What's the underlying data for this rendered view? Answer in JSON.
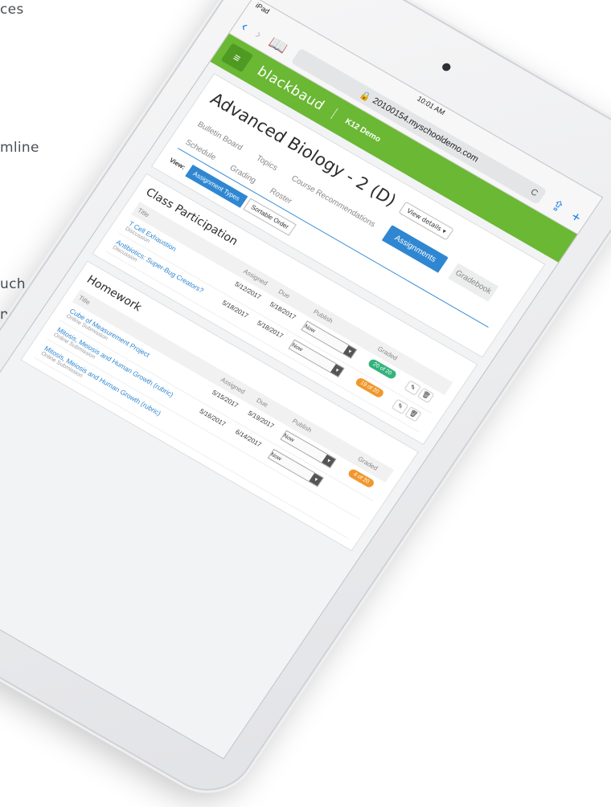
{
  "left_text": [
    "ces",
    "mline",
    "uch",
    "nd"
  ],
  "status": {
    "device": "iPad",
    "time": "10:01 AM"
  },
  "safari": {
    "back": "‹",
    "forward": "›",
    "bookmarks": "📖",
    "url": "20100154.myschooldemo.com",
    "lock": "🔒",
    "reload": "C",
    "share": "⇪",
    "add": "+"
  },
  "header": {
    "logo": "blackbaud",
    "org": "K12 Demo",
    "menu_icon": "≡"
  },
  "course": {
    "title": "Advanced Biology - 2 (D)",
    "view_details": "View details ▾"
  },
  "tabs": [
    "Bulletin Board",
    "Topics",
    "Course Recommendations",
    "Assignments",
    "Gradebook",
    "Schedule",
    "Grading",
    "Roster"
  ],
  "view": {
    "label": "View:",
    "options": [
      "Assignment Types",
      "Sortable Order"
    ]
  },
  "sections": [
    {
      "title": "Class Participation",
      "headers": [
        "Title",
        "Assigned",
        "Due",
        "Publish",
        "Graded"
      ],
      "rows": [
        {
          "title": "T Cell Exhaustion",
          "type": "Discussion",
          "assigned": "5/12/2017",
          "due": "5/18/2017",
          "publish": "Now",
          "graded": "20 of 20",
          "badge": "green"
        },
        {
          "title": "Antibiotics: Super-Bug Creators?",
          "type": "Discussion",
          "assigned": "5/18/2017",
          "due": "5/18/2017",
          "publish": "Now",
          "graded": "19 of 20",
          "badge": "orange"
        }
      ]
    },
    {
      "title": "Homework",
      "headers": [
        "Title",
        "Assigned",
        "Due",
        "Publish",
        "Graded"
      ],
      "rows": [
        {
          "title": "Cube of Measurement Project",
          "type": "Online Submission",
          "assigned": "5/15/2017",
          "due": "5/19/2017",
          "publish": "Now",
          "graded": "4 of 20",
          "badge": "orange"
        },
        {
          "title": "Mitosis, Meiosis and Human Growth (rubric)",
          "type": "Online Submission",
          "assigned": "5/16/2017",
          "due": "6/14/2017",
          "publish": "Now",
          "graded": "",
          "badge": ""
        },
        {
          "title": "Mitosis, Meiosis and Human Growth (rubric)",
          "type": "Online Submission",
          "assigned": "",
          "due": "",
          "publish": "",
          "graded": "",
          "badge": ""
        }
      ]
    }
  ],
  "colors": {
    "header_green": "#6ab833",
    "accent_blue": "#2f87d1",
    "badge_green": "#34b37c",
    "badge_orange": "#f0982e"
  }
}
